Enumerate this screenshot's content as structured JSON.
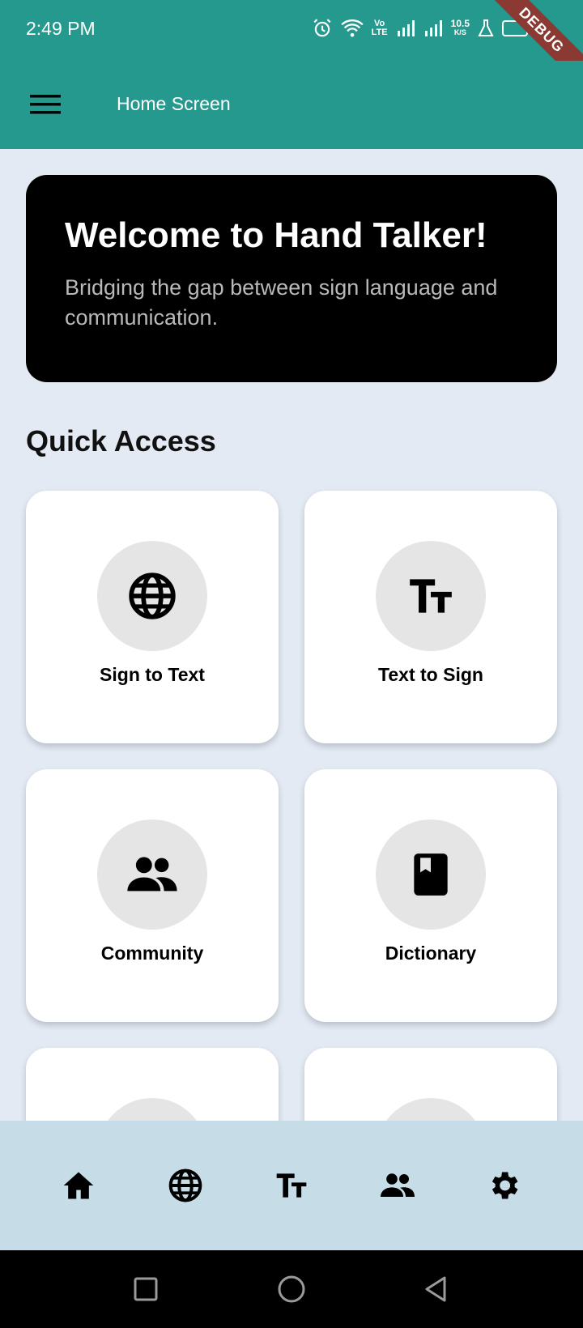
{
  "status": {
    "time": "2:49 PM",
    "volte_top": "Vo",
    "volte_bottom": "LTE",
    "speed_value": "10.5",
    "speed_unit": "K/S",
    "debug_label": "DEBUG"
  },
  "appbar": {
    "title": "Home Screen",
    "menu_icon": "hamburger-menu-icon"
  },
  "welcome": {
    "title": "Welcome to Hand Talker!",
    "subtitle": "Bridging the gap between sign language and communication."
  },
  "quick_access": {
    "title": "Quick Access",
    "items": [
      {
        "label": "Sign to Text",
        "icon": "globe-icon"
      },
      {
        "label": "Text to Sign",
        "icon": "text-size-icon"
      },
      {
        "label": "Community",
        "icon": "people-icon"
      },
      {
        "label": "Dictionary",
        "icon": "book-icon"
      }
    ]
  },
  "bottom_nav": {
    "items": [
      {
        "icon": "home-icon"
      },
      {
        "icon": "globe-icon"
      },
      {
        "icon": "text-size-icon"
      },
      {
        "icon": "people-icon"
      },
      {
        "icon": "settings-gear-icon"
      }
    ]
  },
  "system_nav": {
    "items": [
      {
        "icon": "recents-square-icon"
      },
      {
        "icon": "home-circle-icon"
      },
      {
        "icon": "back-triangle-icon"
      }
    ]
  },
  "colors": {
    "appbar": "#26998e",
    "background": "#e3eaf4",
    "welcome_card": "#000000",
    "card": "#ffffff",
    "icon_circle": "#e5e5e5",
    "bottom_nav": "#c6dce6"
  }
}
